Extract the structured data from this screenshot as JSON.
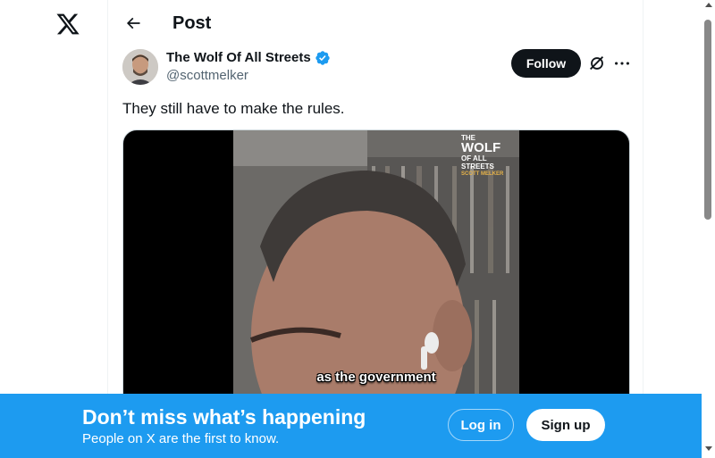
{
  "header": {
    "title": "Post",
    "back_icon": "arrow-left-icon"
  },
  "logo": {
    "icon": "x-logo-icon"
  },
  "post": {
    "author_name": "The Wolf Of All Streets",
    "handle": "@scottmelker",
    "verified": true,
    "follow_label": "Follow",
    "text": "They still have to make the rules.",
    "video_caption": "as the government",
    "watermark": [
      "THE",
      "WOLF",
      "OF ALL STREETS",
      "SCOTT MELKER"
    ]
  },
  "bottom_bar": {
    "title": "Don’t miss what’s happening",
    "subtitle": "People on X are the first to know.",
    "login_label": "Log in",
    "signup_label": "Sign up"
  },
  "colors": {
    "accent": "#1d9bf0",
    "text": "#0f1419",
    "secondary": "#536471"
  }
}
